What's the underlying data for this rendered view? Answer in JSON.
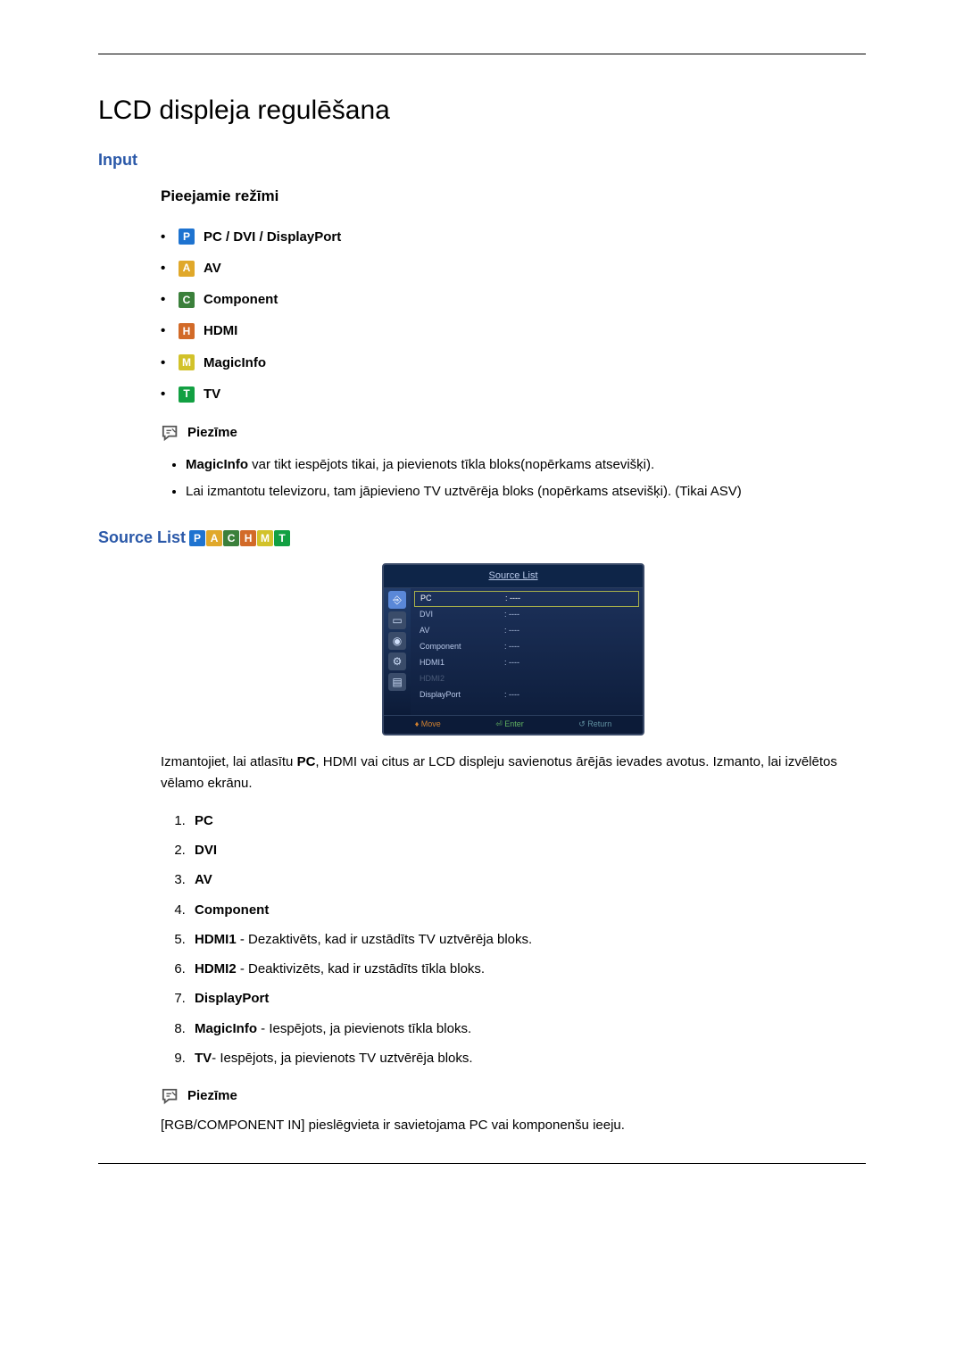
{
  "page": {
    "title": "LCD displeja regulēšana"
  },
  "input_section": {
    "heading": "Input",
    "modes_heading": "Pieejamie režīmi",
    "modes": [
      {
        "badge": "P",
        "label": "PC / DVI / DisplayPort"
      },
      {
        "badge": "A",
        "label": "AV"
      },
      {
        "badge": "C",
        "label": "Component"
      },
      {
        "badge": "H",
        "label": "HDMI"
      },
      {
        "badge": "M",
        "label": "MagicInfo"
      },
      {
        "badge": "T",
        "label": "TV"
      }
    ],
    "note_label": "Piezīme",
    "notes": [
      {
        "bold_start": "MagicInfo",
        "rest": " var tikt iespējots tikai, ja pievienots tīkla bloks(nopērkams atsevišķi)."
      },
      {
        "bold_start": "",
        "rest": "Lai izmantotu televizoru, tam jāpievieno TV uztvērēja bloks (nopērkams atsevišķi). (Tikai ASV)"
      }
    ]
  },
  "source_list": {
    "heading": "Source List",
    "osd": {
      "title": "Source List",
      "rows": [
        {
          "src": "PC",
          "status": "----",
          "selected": true,
          "dim": false
        },
        {
          "src": "DVI",
          "status": "----",
          "selected": false,
          "dim": false
        },
        {
          "src": "AV",
          "status": "----",
          "selected": false,
          "dim": false
        },
        {
          "src": "Component",
          "status": "----",
          "selected": false,
          "dim": false
        },
        {
          "src": "HDMI1",
          "status": "----",
          "selected": false,
          "dim": false
        },
        {
          "src": "HDMI2",
          "status": "",
          "selected": false,
          "dim": true
        },
        {
          "src": "DisplayPort",
          "status": "----",
          "selected": false,
          "dim": false
        }
      ],
      "footer": {
        "move": "♦ Move",
        "enter": "⏎ Enter",
        "return": "↺ Return"
      }
    },
    "intro_pre": "Izmantojiet, lai atlasītu ",
    "intro_bold": "PC",
    "intro_post": ", HDMI vai citus ar LCD displeju savienotus ārējās ievades avotus. Izmanto, lai izvēlētos vēlamo ekrānu.",
    "items": [
      {
        "bold": "PC",
        "rest": ""
      },
      {
        "bold": "DVI",
        "rest": ""
      },
      {
        "bold": "AV",
        "rest": ""
      },
      {
        "bold": "Component",
        "rest": ""
      },
      {
        "bold": "HDMI1",
        "rest": " - Dezaktivēts, kad ir uzstādīts TV uztvērēja bloks."
      },
      {
        "bold": "HDMI2",
        "rest": " - Deaktivizēts, kad ir uzstādīts tīkla bloks."
      },
      {
        "bold": "DisplayPort",
        "rest": ""
      },
      {
        "bold": "MagicInfo",
        "rest": " - Iespējots, ja pievienots tīkla bloks."
      },
      {
        "bold": "TV",
        "rest": "- Iespējots, ja pievienots TV uztvērēja bloks."
      }
    ],
    "note_label": "Piezīme",
    "note_text": "[RGB/COMPONENT IN] pieslēgvieta ir savietojama PC vai komponenšu ieeju."
  }
}
